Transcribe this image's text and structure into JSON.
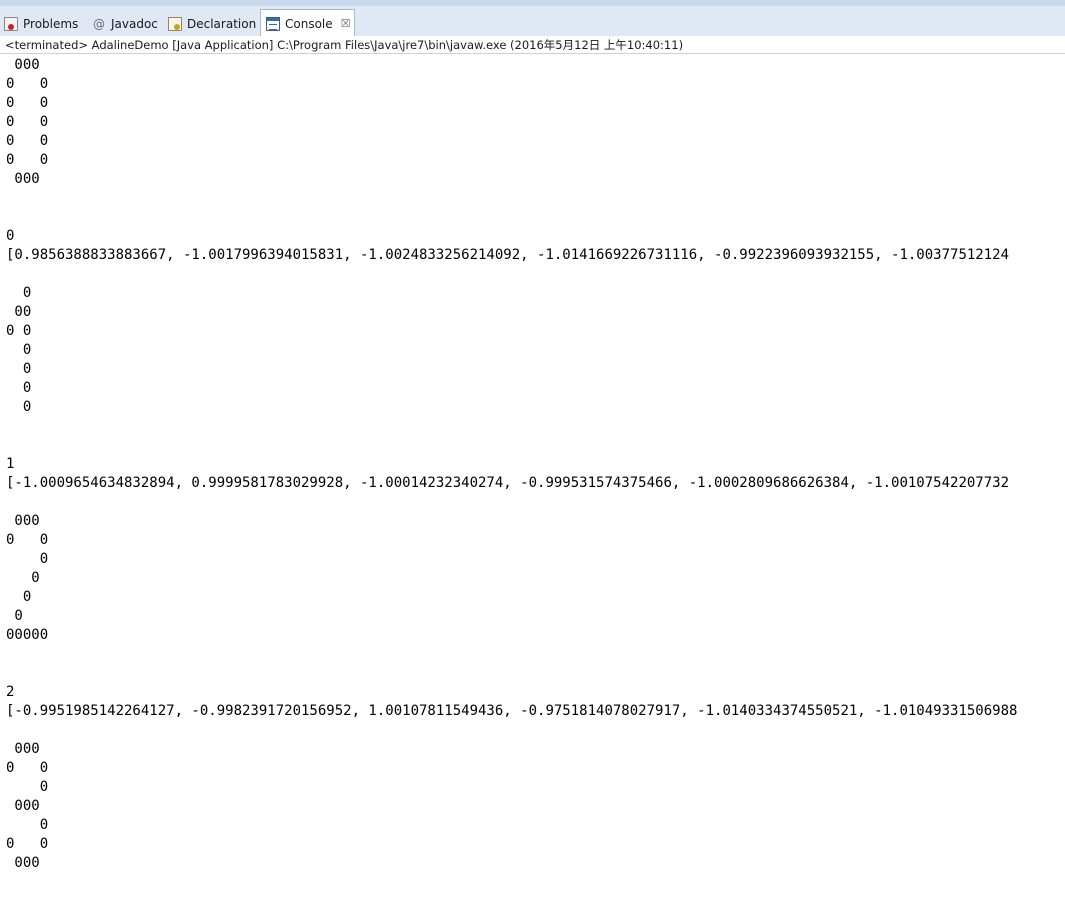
{
  "tabs": [
    {
      "label": "Problems",
      "icon": "problems-icon"
    },
    {
      "label": "Javadoc",
      "icon": "javadoc-icon"
    },
    {
      "label": "Declaration",
      "icon": "declaration-icon"
    },
    {
      "label": "Console",
      "icon": "console-icon",
      "active": true,
      "close": "☒"
    }
  ],
  "status": "<terminated> AdalineDemo [Java Application] C:\\Program Files\\Java\\jre7\\bin\\javaw.exe (2016年5月12日 上午10:40:11)",
  "console_lines": [
    " 000",
    "0   0",
    "0   0",
    "0   0",
    "0   0",
    "0   0",
    " 000",
    "",
    "",
    "0",
    "[0.9856388833883667, -1.0017996394015831, -1.0024833256214092, -1.0141669226731116, -0.9922396093932155, -1.00377512124",
    "",
    "  0",
    " 00",
    "0 0",
    "  0",
    "  0",
    "  0",
    "  0",
    "",
    "",
    "1",
    "[-1.0009654634832894, 0.9999581783029928, -1.00014232340274, -0.999531574375466, -1.0002809686626384, -1.00107542207732",
    "",
    " 000",
    "0   0",
    "    0",
    "   0",
    "  0",
    " 0",
    "00000",
    "",
    "",
    "2",
    "[-0.9951985142264127, -0.9982391720156952, 1.00107811549436, -0.9751814078027917, -1.0140334374550521, -1.01049331506988",
    "",
    " 000",
    "0   0",
    "    0",
    " 000",
    "    0",
    "0   0",
    " 000"
  ],
  "colors": {
    "tabbar_bg": "#dfe8f4",
    "active_tab_bg": "#ffffff",
    "error_red": "#d32020"
  }
}
